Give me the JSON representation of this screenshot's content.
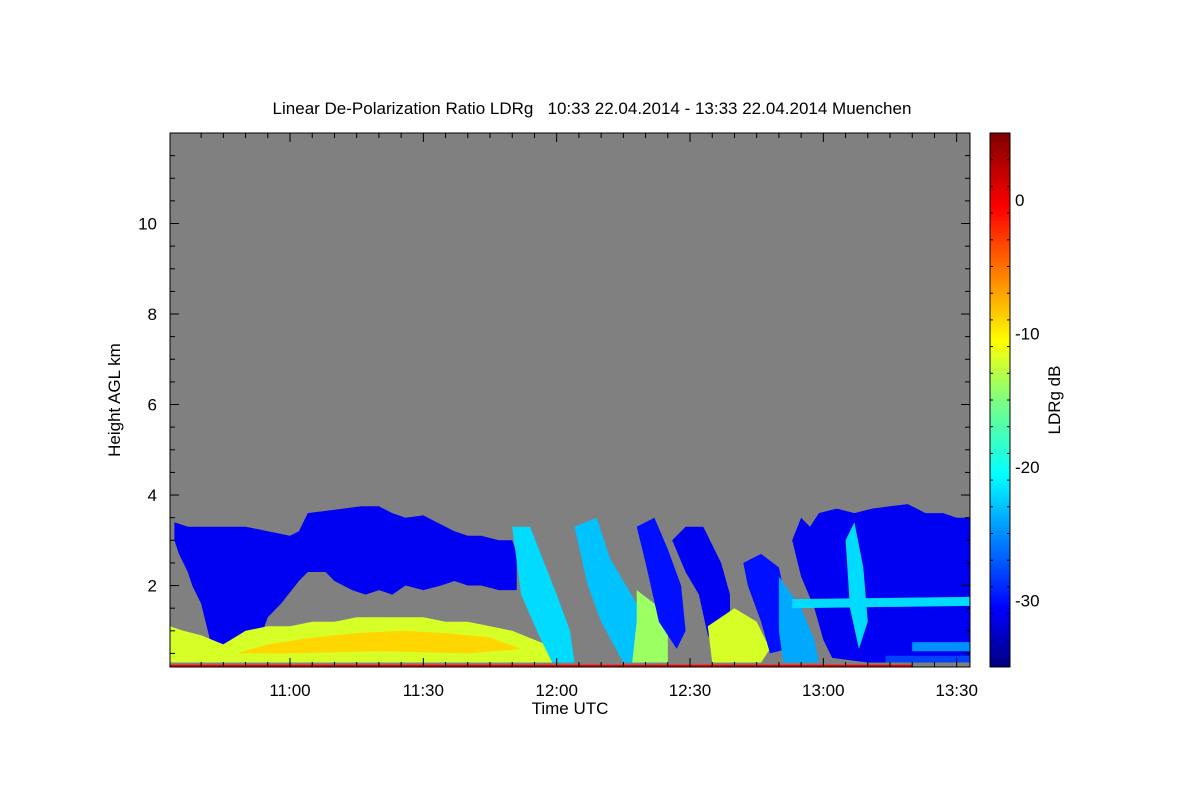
{
  "chart_data": {
    "type": "heatmap",
    "title": "Linear De-Polarization Ratio LDRg   10:33 22.04.2014 - 13:33 22.04.2014 Muenchen",
    "xlabel": "Time UTC",
    "ylabel": "Height AGL km",
    "x_range_minutes_utc": [
      633,
      813
    ],
    "xlim": [
      "10:33",
      "13:33"
    ],
    "ylim": [
      0.2,
      12.0
    ],
    "x_ticks": [
      {
        "minute": 660,
        "label": "11:00"
      },
      {
        "minute": 690,
        "label": "11:30"
      },
      {
        "minute": 720,
        "label": "12:00"
      },
      {
        "minute": 750,
        "label": "12:30"
      },
      {
        "minute": 780,
        "label": "13:00"
      },
      {
        "minute": 810,
        "label": "13:30"
      }
    ],
    "y_ticks": [
      {
        "value": 2,
        "label": "2"
      },
      {
        "value": 4,
        "label": "4"
      },
      {
        "value": 6,
        "label": "6"
      },
      {
        "value": 8,
        "label": "8"
      },
      {
        "value": 10,
        "label": "10"
      }
    ],
    "colorbar": {
      "label": "LDRg dB",
      "range": [
        -35,
        5
      ],
      "ticks": [
        {
          "value": 0,
          "label": "0"
        },
        {
          "value": -10,
          "label": "-10"
        },
        {
          "value": -20,
          "label": "-20"
        },
        {
          "value": -30,
          "label": "-30"
        }
      ],
      "colormap": "jet"
    },
    "background_color": "#808080",
    "regions": [
      {
        "name": "cloud-layer",
        "ldr_db": -31,
        "top_profile": [
          [
            634,
            3.4
          ],
          [
            637,
            3.3
          ],
          [
            640,
            3.3
          ],
          [
            645,
            3.3
          ],
          [
            650,
            3.3
          ],
          [
            655,
            3.2
          ],
          [
            660,
            3.1
          ],
          [
            662,
            3.2
          ],
          [
            664,
            3.6
          ],
          [
            668,
            3.65
          ],
          [
            672,
            3.7
          ],
          [
            676,
            3.75
          ],
          [
            680,
            3.75
          ],
          [
            683,
            3.6
          ],
          [
            686,
            3.5
          ],
          [
            690,
            3.55
          ],
          [
            693,
            3.4
          ],
          [
            697,
            3.2
          ],
          [
            700,
            3.1
          ],
          [
            703,
            3.1
          ],
          [
            707,
            3.0
          ],
          [
            710,
            3.0
          ],
          [
            711,
            2.7
          ]
        ],
        "bottom_profile": [
          [
            711,
            1.9
          ],
          [
            707,
            1.9
          ],
          [
            703,
            2.0
          ],
          [
            700,
            2.0
          ],
          [
            697,
            2.1
          ],
          [
            694,
            2.0
          ],
          [
            690,
            1.9
          ],
          [
            686,
            2.0
          ],
          [
            683,
            1.8
          ],
          [
            680,
            1.9
          ],
          [
            677,
            1.8
          ],
          [
            674,
            1.9
          ],
          [
            670,
            2.1
          ],
          [
            668,
            2.3
          ],
          [
            664,
            2.3
          ],
          [
            662,
            2.1
          ],
          [
            658,
            1.6
          ],
          [
            655,
            1.3
          ],
          [
            652,
            0.5
          ],
          [
            648,
            0.8
          ],
          [
            645,
            0.3
          ],
          [
            642,
            0.8
          ],
          [
            640,
            1.6
          ],
          [
            638,
            2.0
          ],
          [
            637,
            2.3
          ],
          [
            635,
            2.7
          ],
          [
            634,
            3.0
          ]
        ]
      },
      {
        "name": "boundary-layer-aerosol",
        "ldr_db": -12,
        "top_profile": [
          [
            633,
            1.1
          ],
          [
            636,
            1.0
          ],
          [
            640,
            0.9
          ],
          [
            645,
            0.7
          ],
          [
            650,
            1.0
          ],
          [
            655,
            1.1
          ],
          [
            660,
            1.1
          ],
          [
            665,
            1.2
          ],
          [
            670,
            1.2
          ],
          [
            675,
            1.3
          ],
          [
            680,
            1.3
          ],
          [
            685,
            1.3
          ],
          [
            690,
            1.3
          ],
          [
            695,
            1.2
          ],
          [
            700,
            1.2
          ],
          [
            705,
            1.1
          ],
          [
            710,
            1.0
          ],
          [
            715,
            0.8
          ],
          [
            720,
            0.6
          ],
          [
            723,
            0.4
          ]
        ],
        "bottom_value": 0.3
      },
      {
        "name": "boundary-layer-core",
        "ldr_db": -9,
        "points": [
          [
            648,
            0.5
          ],
          [
            655,
            0.7
          ],
          [
            665,
            0.85
          ],
          [
            675,
            0.95
          ],
          [
            685,
            1.0
          ],
          [
            695,
            0.95
          ],
          [
            705,
            0.85
          ],
          [
            712,
            0.6
          ],
          [
            700,
            0.5
          ],
          [
            680,
            0.55
          ],
          [
            660,
            0.5
          ]
        ]
      },
      {
        "name": "virga-1",
        "ldr_db": -22,
        "points": [
          [
            710,
            3.3
          ],
          [
            714,
            3.3
          ],
          [
            720,
            1.8
          ],
          [
            723,
            1.0
          ],
          [
            724,
            0.3
          ],
          [
            719,
            0.3
          ],
          [
            716,
            0.9
          ],
          [
            712,
            1.8
          ]
        ]
      },
      {
        "name": "virga-2",
        "ldr_db": -23,
        "points": [
          [
            724,
            3.3
          ],
          [
            729,
            3.5
          ],
          [
            732,
            2.6
          ],
          [
            738,
            1.6
          ],
          [
            742,
            0.8
          ],
          [
            742,
            0.3
          ],
          [
            735,
            0.3
          ],
          [
            730,
            1.2
          ],
          [
            727,
            2.0
          ]
        ]
      },
      {
        "name": "virga-3",
        "ldr_db": -14,
        "points": [
          [
            738,
            1.9
          ],
          [
            742,
            1.6
          ],
          [
            745,
            1.0
          ],
          [
            745,
            0.3
          ],
          [
            737,
            0.3
          ],
          [
            738,
            1.2
          ]
        ]
      },
      {
        "name": "virga-4",
        "ldr_db": -30,
        "points": [
          [
            738,
            3.3
          ],
          [
            742,
            3.5
          ],
          [
            745,
            2.8
          ],
          [
            748,
            2.0
          ],
          [
            749,
            1.0
          ],
          [
            747,
            0.6
          ],
          [
            743,
            1.2
          ],
          [
            740,
            2.5
          ]
        ]
      },
      {
        "name": "virga-5",
        "ldr_db": -31,
        "points": [
          [
            746,
            3.0
          ],
          [
            749,
            3.3
          ],
          [
            753,
            3.3
          ],
          [
            757,
            2.5
          ],
          [
            759,
            1.8
          ],
          [
            759,
            0.8
          ],
          [
            757,
            0.4
          ],
          [
            754,
            0.9
          ],
          [
            752,
            1.8
          ],
          [
            749,
            2.3
          ]
        ]
      },
      {
        "name": "virga-6",
        "ldr_db": -12,
        "points": [
          [
            754,
            1.1
          ],
          [
            760,
            1.5
          ],
          [
            765,
            1.2
          ],
          [
            768,
            0.6
          ],
          [
            766,
            0.3
          ],
          [
            755,
            0.3
          ]
        ]
      },
      {
        "name": "virga-7",
        "ldr_db": -30,
        "points": [
          [
            762,
            2.5
          ],
          [
            766,
            2.7
          ],
          [
            770,
            2.4
          ],
          [
            772,
            1.5
          ],
          [
            772,
            0.6
          ],
          [
            768,
            0.5
          ],
          [
            766,
            1.2
          ],
          [
            763,
            2.0
          ]
        ]
      },
      {
        "name": "virga-8",
        "ldr_db": -24,
        "points": [
          [
            770,
            2.2
          ],
          [
            775,
            1.5
          ],
          [
            778,
            0.8
          ],
          [
            779,
            0.3
          ],
          [
            771,
            0.3
          ],
          [
            770,
            1.0
          ]
        ]
      },
      {
        "name": "right-cloud-mass",
        "ldr_db": -31,
        "points": [
          [
            773,
            3.0
          ],
          [
            775,
            3.5
          ],
          [
            777,
            3.3
          ],
          [
            779,
            3.6
          ],
          [
            783,
            3.7
          ],
          [
            787,
            3.6
          ],
          [
            791,
            3.7
          ],
          [
            795,
            3.75
          ],
          [
            799,
            3.8
          ],
          [
            803,
            3.6
          ],
          [
            807,
            3.6
          ],
          [
            810,
            3.5
          ],
          [
            813,
            3.5
          ],
          [
            813,
            0.3
          ],
          [
            800,
            0.3
          ],
          [
            790,
            0.3
          ],
          [
            782,
            0.4
          ],
          [
            780,
            0.8
          ],
          [
            778,
            1.5
          ],
          [
            775,
            2.2
          ]
        ]
      },
      {
        "name": "right-light-streaks",
        "ldr_db": -22,
        "points": [
          [
            785,
            3.0
          ],
          [
            787,
            3.4
          ],
          [
            789,
            2.4
          ],
          [
            790,
            1.2
          ],
          [
            788,
            0.6
          ],
          [
            786,
            1.5
          ]
        ]
      },
      {
        "name": "right-layer-1.6km",
        "ldr_db": -22,
        "points": [
          [
            773,
            1.7
          ],
          [
            813,
            1.75
          ],
          [
            813,
            1.55
          ],
          [
            773,
            1.5
          ]
        ]
      },
      {
        "name": "right-lower-layer",
        "ldr_db": -25,
        "points": [
          [
            800,
            0.75
          ],
          [
            813,
            0.75
          ],
          [
            813,
            0.55
          ],
          [
            800,
            0.55
          ]
        ]
      },
      {
        "name": "right-ground-band",
        "ldr_db": -28,
        "points": [
          [
            794,
            0.45
          ],
          [
            813,
            0.45
          ],
          [
            813,
            0.3
          ],
          [
            794,
            0.3
          ]
        ]
      },
      {
        "name": "near-ground-line",
        "ldr_db": 0,
        "points": [
          [
            633,
            0.25
          ],
          [
            800,
            0.25
          ],
          [
            800,
            0.2
          ],
          [
            633,
            0.2
          ]
        ]
      }
    ]
  }
}
